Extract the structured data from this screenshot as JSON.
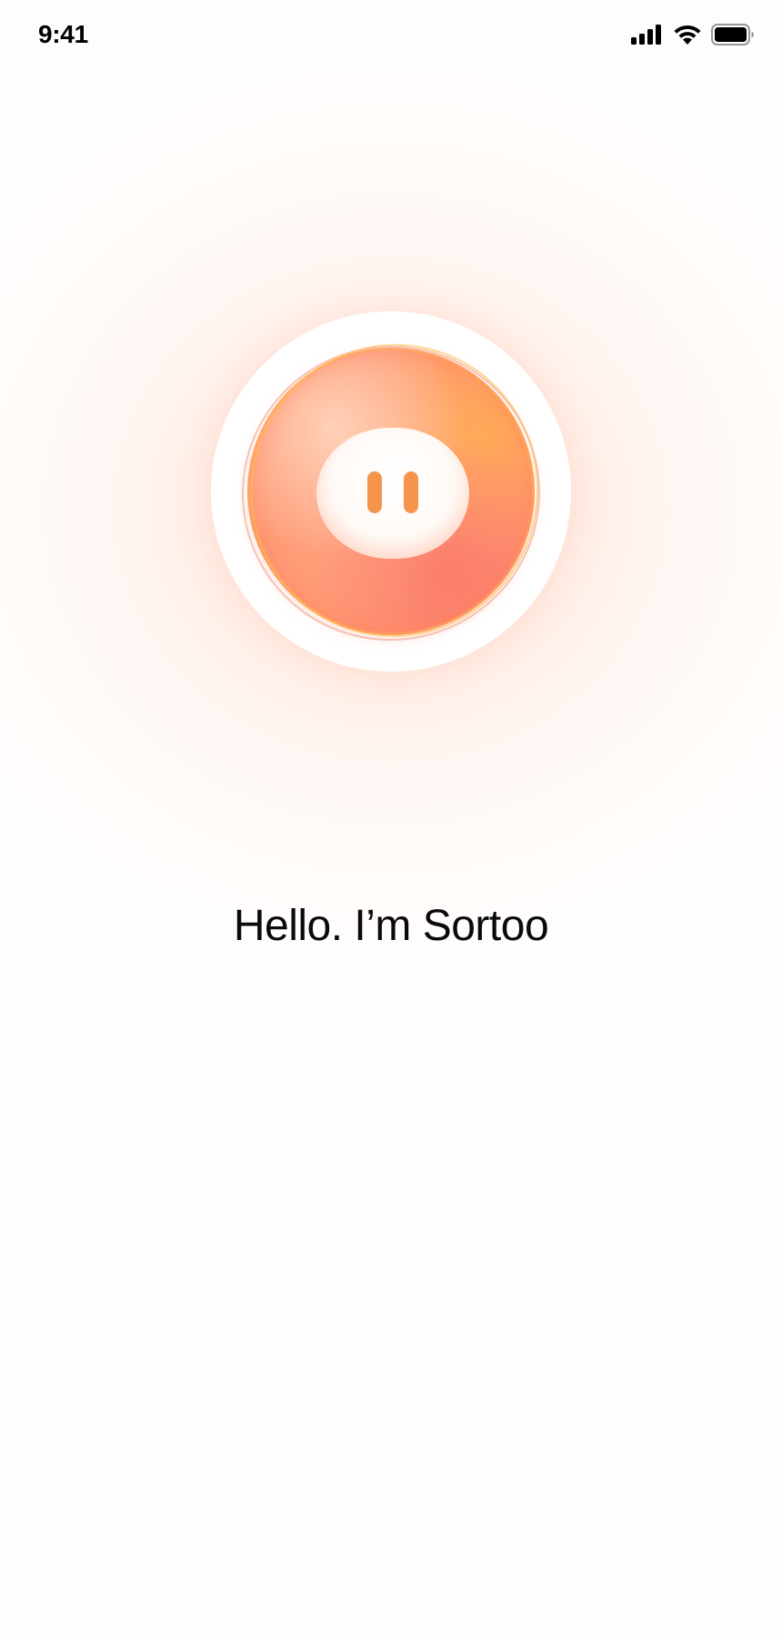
{
  "status_bar": {
    "time": "9:41",
    "signal_icon": "cellular-signal-icon",
    "wifi_icon": "wifi-icon",
    "battery_icon": "battery-icon"
  },
  "mascot": {
    "name": "sortoo-mascot",
    "eye_color": "#f5944d"
  },
  "greeting": "Hello. I’m Sortoo",
  "colors": {
    "background": "#fffdfc",
    "accent": "#ff9c78",
    "text": "#0a0a0a"
  }
}
